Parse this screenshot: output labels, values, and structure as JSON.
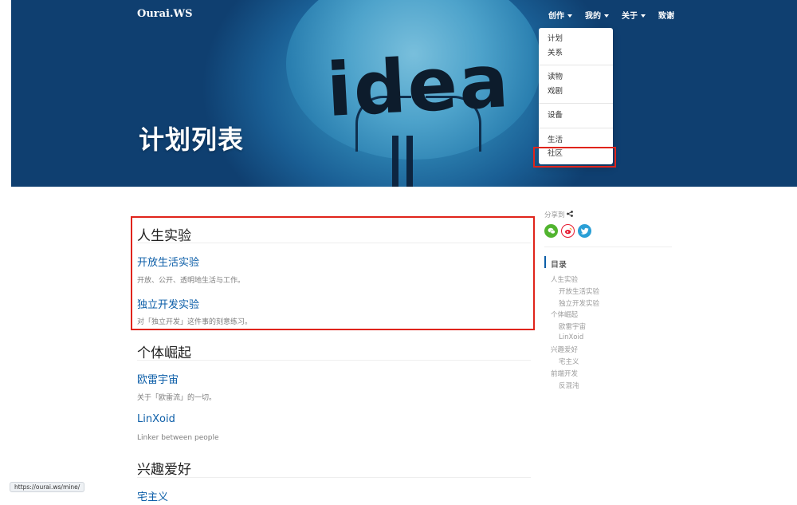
{
  "header": {
    "brand": "Ourai.WS",
    "nav": [
      {
        "label": "创作",
        "has_caret": true
      },
      {
        "label": "我的",
        "has_caret": true
      },
      {
        "label": "关于",
        "has_caret": true
      },
      {
        "label": "致谢",
        "has_caret": false
      }
    ],
    "hero_image_word": "idea",
    "page_title": "计划列表"
  },
  "dropdown": {
    "groups": [
      [
        "计划",
        "关系"
      ],
      [
        "读物",
        "戏剧"
      ],
      [
        "设备"
      ],
      [
        "生活",
        "社区"
      ]
    ]
  },
  "main": {
    "sections": [
      {
        "heading": "人生实验",
        "posts": [
          {
            "title": "开放生活实验",
            "desc": "开放、公开、透明地生活与工作。"
          },
          {
            "title": "独立开发实验",
            "desc": "对「独立开发」这件事的刻意练习。"
          }
        ]
      },
      {
        "heading": "个体崛起",
        "posts": [
          {
            "title": "欧雷宇宙",
            "desc": "关于「欧雷流」的一切。"
          },
          {
            "title": "LinXoid",
            "desc": "Linker between people"
          }
        ]
      },
      {
        "heading": "兴趣爱好",
        "posts": [
          {
            "title": "宅主义",
            "desc": ""
          }
        ]
      }
    ]
  },
  "sidebar": {
    "share_label": "分享到",
    "share_icon": "share-nodes-icon",
    "social": [
      {
        "name": "wechat-icon",
        "color": "#51b42f"
      },
      {
        "name": "weibo-icon",
        "color": "#e6162d"
      },
      {
        "name": "twitter-icon",
        "color": "#2a9fd6"
      }
    ],
    "toc_title": "目录",
    "toc": [
      {
        "label": "人生实验",
        "level": 1
      },
      {
        "label": "开放生活实验",
        "level": 2
      },
      {
        "label": "独立开发实验",
        "level": 2
      },
      {
        "label": "个体崛起",
        "level": 1
      },
      {
        "label": "欧雷宇宙",
        "level": 2
      },
      {
        "label": "LinXoid",
        "level": 2
      },
      {
        "label": "兴趣爱好",
        "level": 1
      },
      {
        "label": "宅主义",
        "level": 2
      },
      {
        "label": "前端开发",
        "level": 1
      },
      {
        "label": "反混沌",
        "level": 2
      }
    ]
  },
  "status_bar": {
    "url": "https://ourai.ws/mine/"
  },
  "colors": {
    "link": "#0c5ea8",
    "highlight": "#e0241b"
  }
}
